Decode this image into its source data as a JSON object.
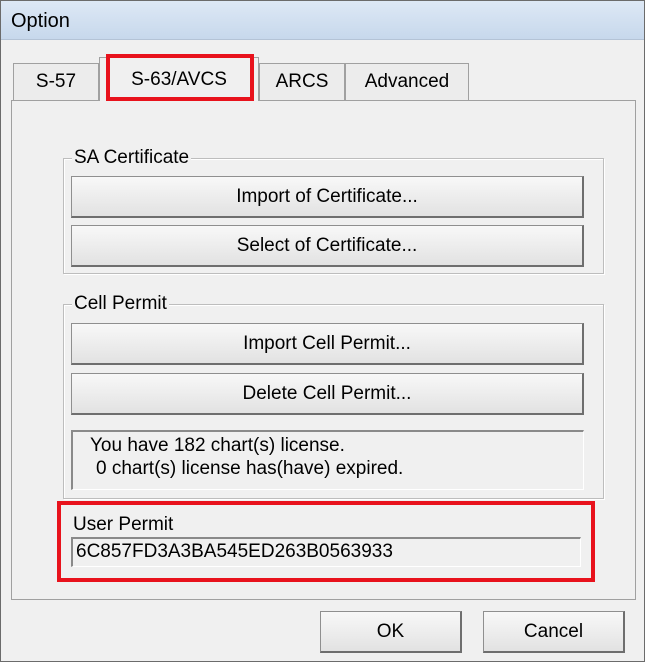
{
  "window": {
    "title": "Option"
  },
  "tabs": [
    {
      "label": "S-57",
      "active": false
    },
    {
      "label": "S-63/AVCS",
      "active": true
    },
    {
      "label": "ARCS",
      "active": false
    },
    {
      "label": "Advanced",
      "active": false
    }
  ],
  "sa_certificate": {
    "label": "SA Certificate",
    "import_button": "Import of Certificate...",
    "select_button": "Select of Certificate..."
  },
  "cell_permit": {
    "label": "Cell Permit",
    "import_button": "Import Cell Permit...",
    "delete_button": "Delete Cell Permit...",
    "status_line1": "You have 182 chart(s) license.",
    "status_line2": "0 chart(s) license has(have) expired."
  },
  "user_permit": {
    "label": "User Permit",
    "value": "6C857FD3A3BA545ED263B0563933"
  },
  "footer": {
    "ok_button": "OK",
    "cancel_button": "Cancel"
  },
  "highlight_color": "#e8121c"
}
